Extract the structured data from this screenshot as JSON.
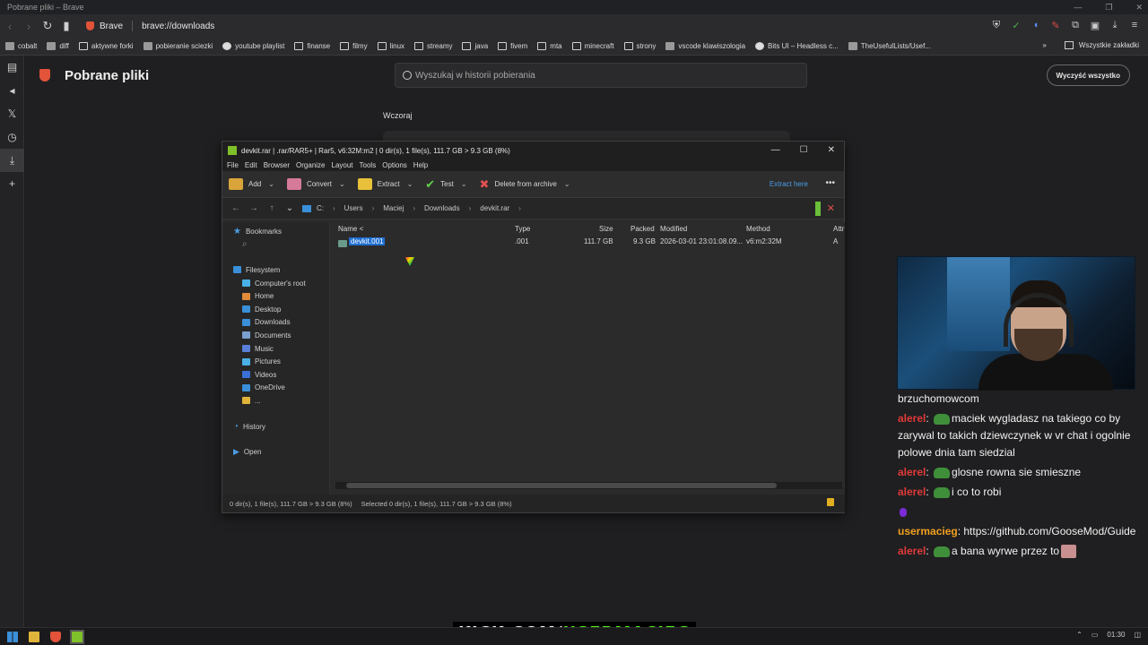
{
  "window": {
    "title": "Pobrane pliki – Brave"
  },
  "addressbar": {
    "brand": "Brave",
    "url": "brave://downloads"
  },
  "bookmarks": [
    {
      "label": "cobalt",
      "icon": "cobalt-icon"
    },
    {
      "label": "diff",
      "icon": "diff-icon"
    },
    {
      "label": "aktywne forki",
      "icon": "folder-icon"
    },
    {
      "label": "pobieranie sciezki",
      "icon": "download-site-icon"
    },
    {
      "label": "youtube playlist",
      "icon": "globe-icon"
    },
    {
      "label": "finanse",
      "icon": "folder-icon"
    },
    {
      "label": "filmy",
      "icon": "folder-icon"
    },
    {
      "label": "linux",
      "icon": "folder-icon"
    },
    {
      "label": "streamy",
      "icon": "folder-icon"
    },
    {
      "label": "java",
      "icon": "folder-icon"
    },
    {
      "label": "fivem",
      "icon": "folder-icon"
    },
    {
      "label": "mta",
      "icon": "folder-icon"
    },
    {
      "label": "minecraft",
      "icon": "folder-icon"
    },
    {
      "label": "strony",
      "icon": "folder-icon"
    },
    {
      "label": "vscode klawiszologia",
      "icon": "vscode-icon"
    },
    {
      "label": "Bits UI – Headless c...",
      "icon": "bits-ui-icon"
    },
    {
      "label": "TheUsefulLists/Usef...",
      "icon": "github-icon"
    }
  ],
  "bookmarks_all": "Wszystkie zakładki",
  "downloads_page": {
    "title": "Pobrane pliki",
    "search_placeholder": "Wyszukaj w historii pobierania",
    "clear_all": "Wyczyść wszystko",
    "section_label": "Wczoraj"
  },
  "rar": {
    "title": "devkit.rar | .rar/RAR5+ | Rar5, v6:32M:m2 | 0 dir(s), 1 file(s), 111.7 GB > 9.3 GB (8%)",
    "menu": [
      "File",
      "Edit",
      "Browser",
      "Organize",
      "Layout",
      "Tools",
      "Options",
      "Help"
    ],
    "toolbar": {
      "add": "Add",
      "convert": "Convert",
      "extract": "Extract",
      "test": "Test",
      "delete": "Delete from archive",
      "extract_here": "Extract here"
    },
    "breadcrumbs": [
      "C:",
      "Users",
      "Maciej",
      "Downloads",
      "devkit.rar"
    ],
    "left_pane": {
      "bookmarks": "Bookmarks",
      "filesystem": "Filesystem",
      "items": [
        "Computer's root",
        "Home",
        "Desktop",
        "Downloads",
        "Documents",
        "Music",
        "Pictures",
        "Videos",
        "OneDrive",
        "..."
      ],
      "history": "History",
      "open": "Open"
    },
    "columns": [
      "Name <",
      "Type",
      "Size",
      "Packed",
      "Modified",
      "Method",
      "Attr"
    ],
    "rows": [
      {
        "name": "devkit.001",
        "type": ".001",
        "size": "111.7 GB",
        "packed": "9.3 GB",
        "modified": "2026-03-01 23:01:08.09...",
        "method": "v6:m2:32M",
        "attr": "A"
      }
    ],
    "status_left": "0 dir(s), 1 file(s), 111.7 GB > 9.3 GB (8%)",
    "status_right": "Selected 0 dir(s), 1 file(s), 111.7 GB > 9.3 GB (8%)"
  },
  "chat": [
    {
      "user": "",
      "text": "brzuchomowcom",
      "emote": false,
      "user_color": "red"
    },
    {
      "user": "alerel",
      "text": "maciek wygladasz na takiego co by zarywal to takich dziewczynek w vr chat i ogolnie polowe dnia tam siedzial",
      "emote": true,
      "user_color": "red"
    },
    {
      "user": "alerel",
      "text": "glosne rowna sie smieszne",
      "emote": true,
      "user_color": "red"
    },
    {
      "user": "alerel",
      "text": "i co to robi",
      "emote": true,
      "user_color": "red"
    },
    {
      "user": "usermacieg",
      "text": "https://github.com/GooseMod/Guide",
      "emote": false,
      "user_color": "orange"
    },
    {
      "user": "alerel",
      "text": "a bana wyrwe przez to",
      "emote": true,
      "user_color": "red"
    }
  ],
  "overlay": {
    "kick_prefix": "KICK.COM/",
    "kick_channel": "USERMACIEG"
  },
  "taskbar": {
    "time": "01:30"
  },
  "colors": {
    "accent_blue": "#1f6fd1",
    "rar_green": "#7fc12a",
    "kick_green": "#53fc18",
    "chat_red": "#e03a3a",
    "chat_orange": "#f0a020"
  }
}
